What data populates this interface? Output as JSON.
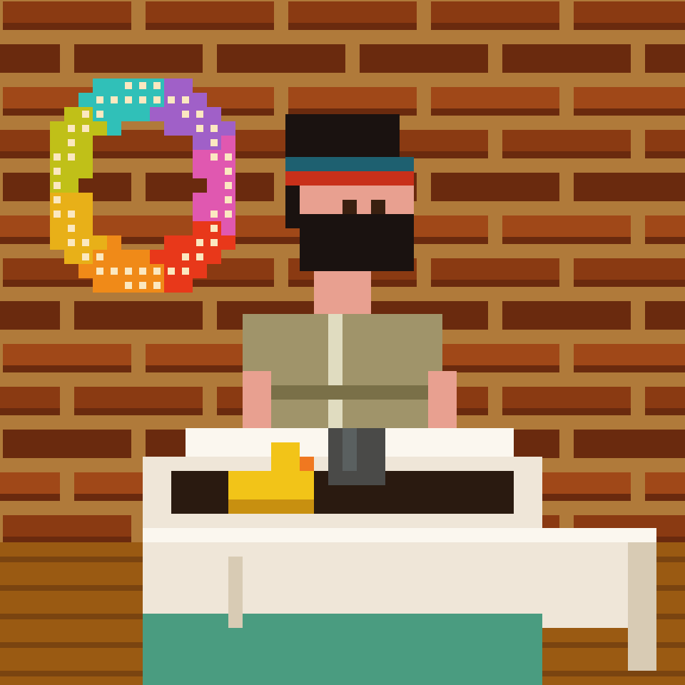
{
  "scene": {
    "title": "",
    "subject": "",
    "palette": {
      "mortar": "#b07a3a",
      "brick": "#8a3a12",
      "brick_dark": "#6a2a0e",
      "brick_light": "#a04818",
      "floor": "#9a5a12",
      "floor_dark": "#7a4410",
      "tub": "#efe6d8",
      "tub_shade": "#d8cbb4",
      "tub_highlight": "#fbf7ef",
      "water": "#4a9c80",
      "skin": "#e8a090",
      "skin_shade": "#d88070",
      "beard": "#1a1210",
      "bandana_red": "#c8301a",
      "bandana_blue": "#1e6070",
      "shirt": "#a0946a",
      "shirt_dark": "#7a7048",
      "mug": "#4a4a48",
      "duck": "#f2c418",
      "duck_beak": "#f07820",
      "dirt": "#2a1a10"
    },
    "icons": [
      "rainbow-ring-icon",
      "rubber-duck-icon",
      "mug-icon"
    ]
  }
}
